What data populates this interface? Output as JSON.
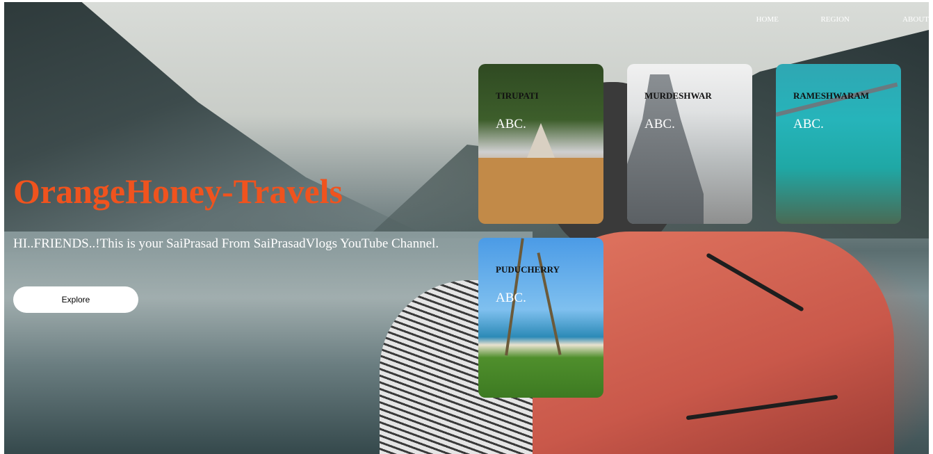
{
  "nav": {
    "home": "HOME",
    "region": "REGION",
    "about": "ABOUT"
  },
  "hero": {
    "title": "OrangeHoney-Travels",
    "tagline": "HI..FRIENDS..!This is your SaiPrasad From SaiPrasadVlogs YouTube Channel.",
    "explore_label": "Explore"
  },
  "cards": [
    {
      "name": "TIRUPATI",
      "sub": "ABC."
    },
    {
      "name": "MURDESHWAR",
      "sub": "ABC."
    },
    {
      "name": "RAMESHWARAM",
      "sub": "ABC."
    },
    {
      "name": "PUDUCHERRY",
      "sub": "ABC."
    }
  ],
  "colors": {
    "title": "#f0531e",
    "button_bg": "#ffffff",
    "nav_text": "#ffffff"
  }
}
